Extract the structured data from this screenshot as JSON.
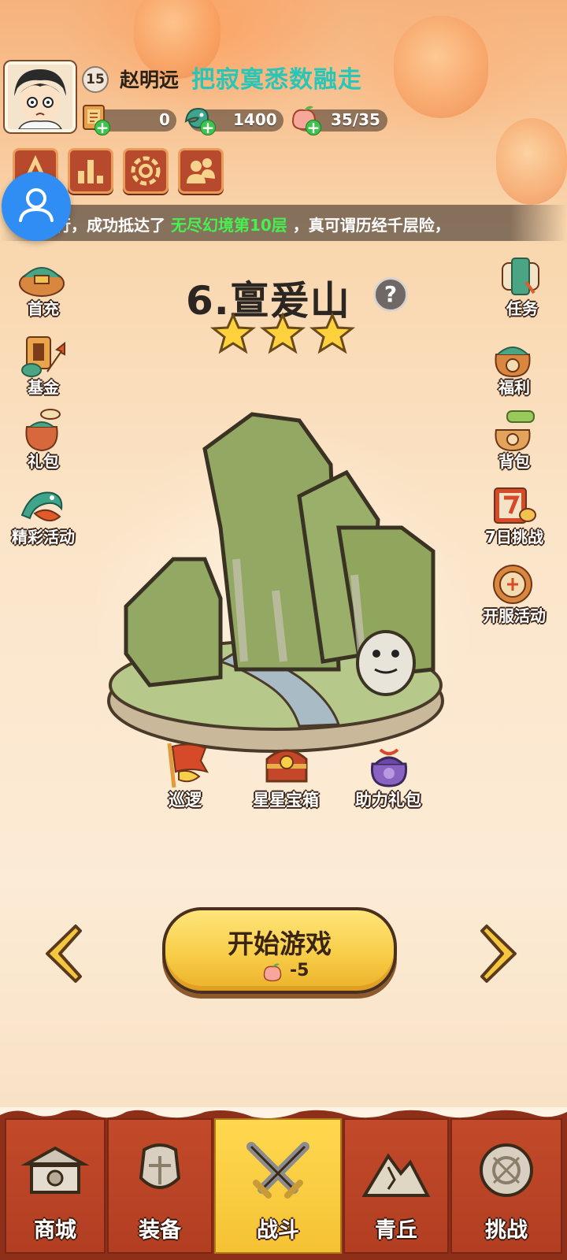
{
  "header": {
    "level": "15",
    "player_name": "赵明远",
    "guild_name": "把寂寞悉数融走",
    "resources": [
      {
        "icon": "scroll-ticket-icon",
        "value": "0"
      },
      {
        "icon": "jade-dragon-icon",
        "value": "1400"
      },
      {
        "icon": "peach-stamina-icon",
        "value": "35/35"
      }
    ],
    "top_buttons": [
      "cultivate-icon",
      "ranking-icon",
      "settings-icon",
      "friends-icon"
    ]
  },
  "marquee": {
    "prefix": "行，成功抵达了",
    "highlight": "无尽幻境第10层",
    "suffix": "，真可谓历经千层险，"
  },
  "left_menu": [
    {
      "label": "首充",
      "icon": "first-recharge-icon"
    },
    {
      "label": "基金",
      "icon": "fund-icon"
    },
    {
      "label": "礼包",
      "icon": "gift-pack-icon"
    },
    {
      "label": "精彩活动",
      "icon": "events-icon"
    }
  ],
  "right_menu": [
    {
      "label": "任务",
      "icon": "tasks-icon"
    },
    {
      "label": "福利",
      "icon": "welfare-icon"
    },
    {
      "label": "背包",
      "icon": "backpack-icon"
    },
    {
      "label": "7日挑战",
      "icon": "seven-day-challenge-icon"
    },
    {
      "label": "开服活动",
      "icon": "server-launch-icon"
    }
  ],
  "stage": {
    "title": "6.亶爰山",
    "help": "?",
    "stars": 3
  },
  "rewards": [
    {
      "label": "巡逻",
      "icon": "patrol-flag-icon"
    },
    {
      "label": "星星宝箱",
      "icon": "star-chest-icon"
    },
    {
      "label": "助力礼包",
      "icon": "support-bag-icon"
    }
  ],
  "start": {
    "label": "开始游戏",
    "cost": "-5"
  },
  "bottom_nav": [
    {
      "label": "商城",
      "icon": "shop-icon",
      "active": false
    },
    {
      "label": "装备",
      "icon": "equipment-icon",
      "active": false
    },
    {
      "label": "战斗",
      "icon": "battle-swords-icon",
      "active": true
    },
    {
      "label": "青丘",
      "icon": "qingqiu-mountain-icon",
      "active": false
    },
    {
      "label": "挑战",
      "icon": "challenge-gong-icon",
      "active": false
    }
  ],
  "colors": {
    "accent_teal": "#29c6b8",
    "highlight_green": "#45f04f",
    "button_yellow": "#f8cd48",
    "nav_red": "#b23e22",
    "floating_blue": "#2f8df4"
  }
}
